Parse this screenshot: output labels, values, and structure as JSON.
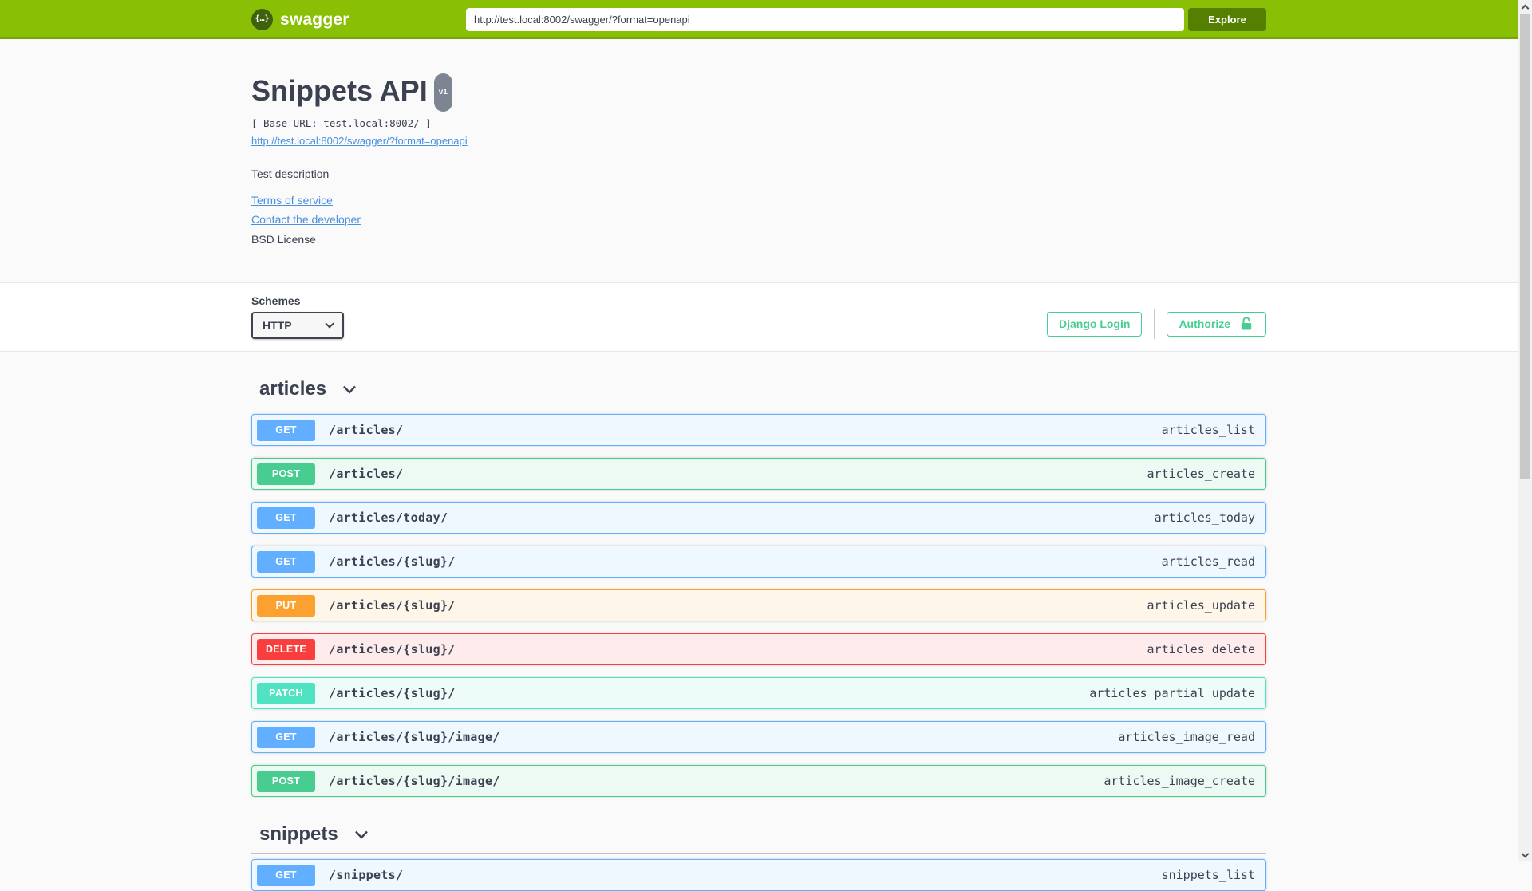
{
  "topbar": {
    "brand": "swagger",
    "logo_glyph": "{…}",
    "url_value": "http://test.local:8002/swagger/?format=openapi",
    "explore_label": "Explore"
  },
  "info": {
    "title": "Snippets API",
    "version_badge": "v1",
    "base_url_line": "[ Base URL: test.local:8002/ ]",
    "spec_link": "http://test.local:8002/swagger/?format=openapi",
    "description": "Test description",
    "terms_link": "Terms of service",
    "contact_link": "Contact the developer",
    "license_text": "BSD License"
  },
  "schemes": {
    "label": "Schemes",
    "selected": "HTTP"
  },
  "auth": {
    "django_login_label": "Django Login",
    "authorize_label": "Authorize"
  },
  "colors": {
    "brand_green": "#89bf04",
    "explore_green": "#547f00",
    "link_blue": "#4990e2",
    "heading_text": "#3b4151",
    "auth_green": "#49cc90",
    "version_badge_bg": "#7d8492",
    "methods": {
      "GET": {
        "badge": "#61affe",
        "row_bg": "#eff7ff",
        "row_border": "#61affe"
      },
      "POST": {
        "badge": "#49cc90",
        "row_bg": "#edfaf4",
        "row_border": "#49cc90"
      },
      "PUT": {
        "badge": "#fca130",
        "row_bg": "#fff6ea",
        "row_border": "#fca130"
      },
      "DELETE": {
        "badge": "#f93e3e",
        "row_bg": "#feecec",
        "row_border": "#f93e3e"
      },
      "PATCH": {
        "badge": "#50e3c2",
        "row_bg": "#eefcf9",
        "row_border": "#50e3c2"
      }
    }
  },
  "sections": [
    {
      "name": "articles",
      "operations": [
        {
          "method": "GET",
          "path": "/articles/",
          "operation_id": "articles_list"
        },
        {
          "method": "POST",
          "path": "/articles/",
          "operation_id": "articles_create"
        },
        {
          "method": "GET",
          "path": "/articles/today/",
          "operation_id": "articles_today"
        },
        {
          "method": "GET",
          "path": "/articles/{slug}/",
          "operation_id": "articles_read"
        },
        {
          "method": "PUT",
          "path": "/articles/{slug}/",
          "operation_id": "articles_update"
        },
        {
          "method": "DELETE",
          "path": "/articles/{slug}/",
          "operation_id": "articles_delete"
        },
        {
          "method": "PATCH",
          "path": "/articles/{slug}/",
          "operation_id": "articles_partial_update"
        },
        {
          "method": "GET",
          "path": "/articles/{slug}/image/",
          "operation_id": "articles_image_read"
        },
        {
          "method": "POST",
          "path": "/articles/{slug}/image/",
          "operation_id": "articles_image_create"
        }
      ]
    },
    {
      "name": "snippets",
      "operations": [
        {
          "method": "GET",
          "path": "/snippets/",
          "operation_id": "snippets_list"
        }
      ]
    }
  ]
}
